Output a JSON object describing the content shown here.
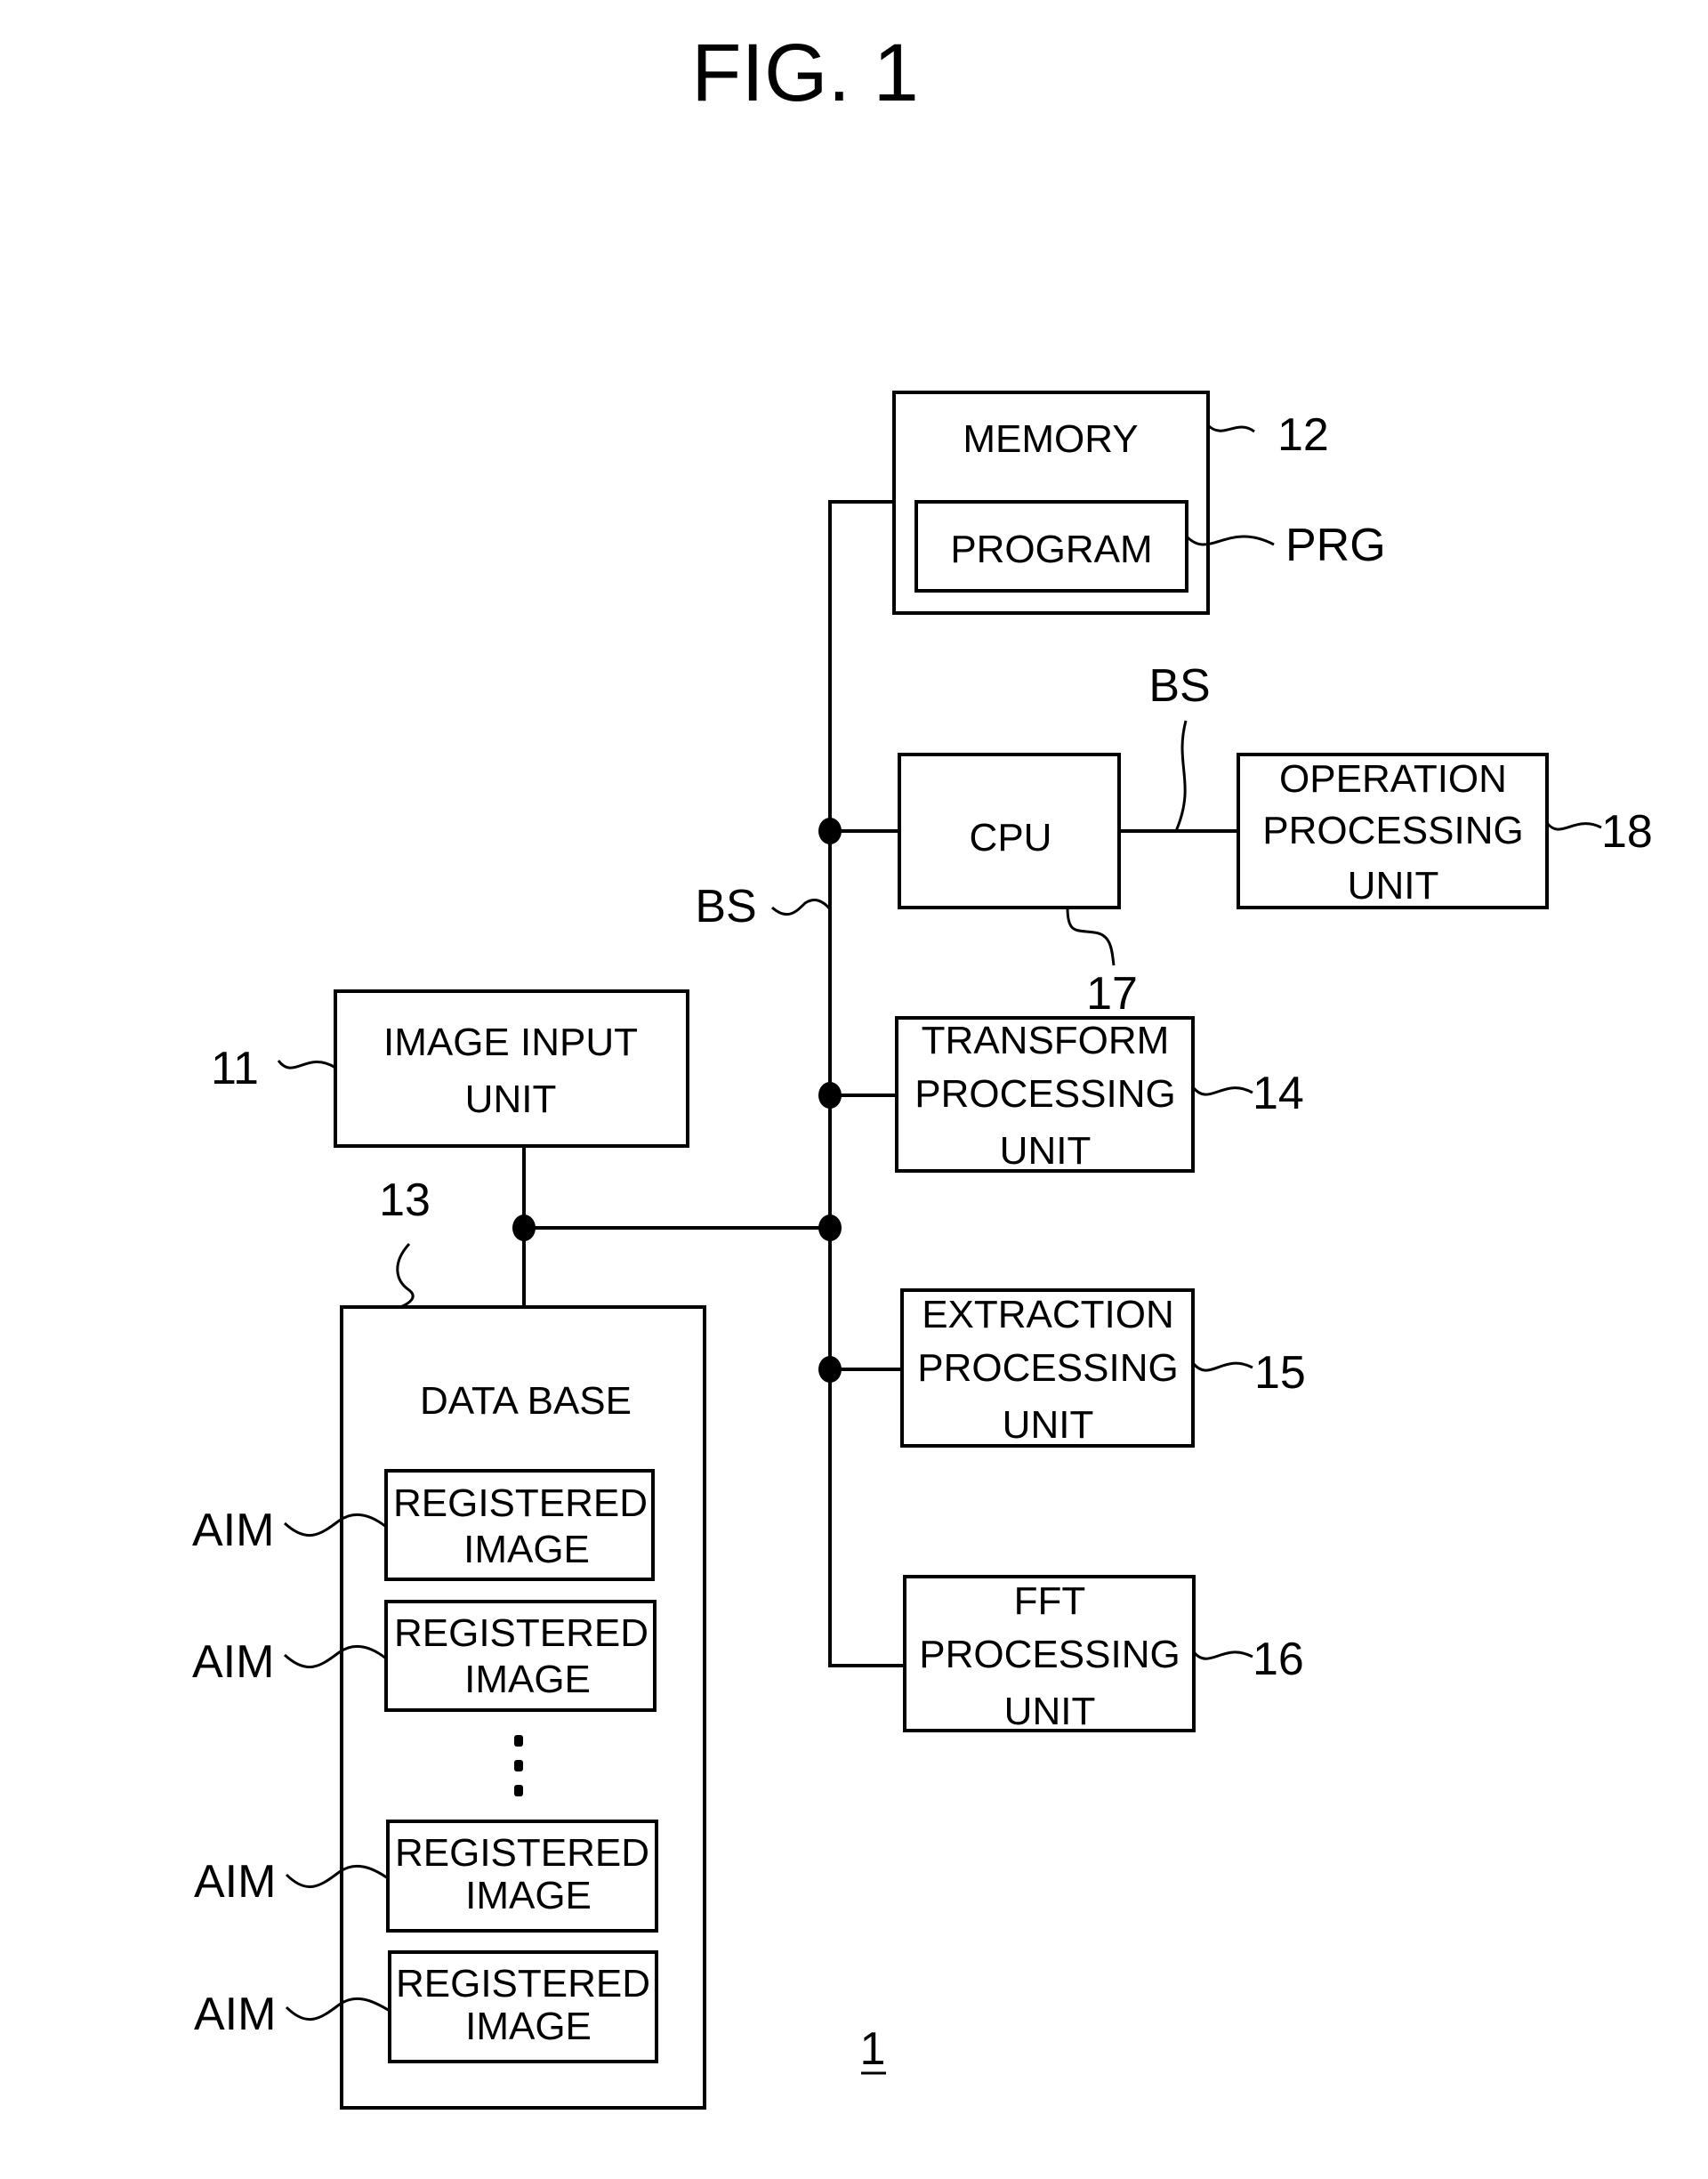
{
  "figure": {
    "title": "FIG. 1",
    "system_ref": "1"
  },
  "memory": {
    "label": "MEMORY",
    "ref": "12",
    "program": {
      "label": "PROGRAM",
      "ref": "PRG"
    }
  },
  "cpu": {
    "label": "CPU",
    "ref": "17"
  },
  "operation_unit": {
    "lines": [
      "OPERATION",
      "PROCESSING",
      "UNIT"
    ],
    "ref": "18"
  },
  "bus": {
    "label_top": "BS",
    "label_left": "BS"
  },
  "image_input_unit": {
    "lines": [
      "IMAGE INPUT",
      "UNIT"
    ],
    "ref": "11"
  },
  "transform_unit": {
    "lines": [
      "TRANSFORM",
      "PROCESSING",
      "UNIT"
    ],
    "ref": "14"
  },
  "extraction_unit": {
    "lines": [
      "EXTRACTION",
      "PROCESSING",
      "UNIT"
    ],
    "ref": "15"
  },
  "fft_unit": {
    "lines": [
      "FFT",
      "PROCESSING",
      "UNIT"
    ],
    "ref": "16"
  },
  "database": {
    "label": "DATA BASE",
    "ref": "13",
    "registered_images": [
      {
        "lines": [
          "REGISTERED",
          "IMAGE"
        ],
        "ref": "AIM"
      },
      {
        "lines": [
          "REGISTERED",
          "IMAGE"
        ],
        "ref": "AIM"
      },
      {
        "lines": [
          "REGISTERED",
          "IMAGE"
        ],
        "ref": "AIM"
      },
      {
        "lines": [
          "REGISTERED",
          "IMAGE"
        ],
        "ref": "AIM"
      }
    ],
    "ellipsis": "⋮"
  }
}
